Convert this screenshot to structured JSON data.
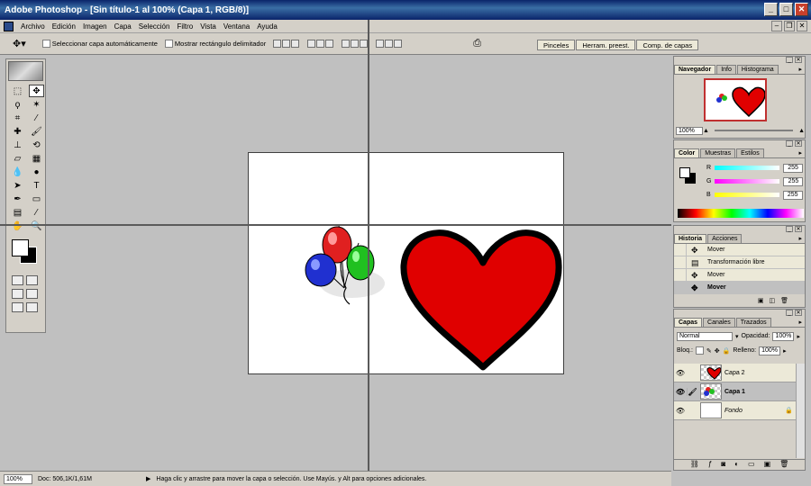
{
  "window": {
    "title": "Adobe Photoshop - [Sin título-1 al 100% (Capa 1, RGB/8)]"
  },
  "menu": [
    "Archivo",
    "Edición",
    "Imagen",
    "Capa",
    "Selección",
    "Filtro",
    "Vista",
    "Ventana",
    "Ayuda"
  ],
  "options": {
    "auto_select_label": "Seleccionar capa automáticamente",
    "show_bounds_label": "Mostrar rectángulo delimitador"
  },
  "wells": [
    "Pinceles",
    "Herram. preest.",
    "Comp. de capas"
  ],
  "navigator": {
    "tabs": [
      "Navegador",
      "Info",
      "Histograma"
    ],
    "zoom": "100%"
  },
  "color": {
    "tabs": [
      "Color",
      "Muestras",
      "Estilos"
    ],
    "r_label": "R",
    "g_label": "G",
    "b_label": "B",
    "r": "255",
    "g": "255",
    "b": "255"
  },
  "history": {
    "tabs": [
      "Historia",
      "Acciones"
    ],
    "items": [
      "Mover",
      "Transformación libre",
      "Mover",
      "Mover"
    ]
  },
  "layers": {
    "tabs": [
      "Capas",
      "Canales",
      "Trazados"
    ],
    "blend_mode": "Normal",
    "opacity_label": "Opacidad:",
    "opacity": "100%",
    "lock_label": "Bloq.:",
    "fill_label": "Relleno:",
    "fill": "100%",
    "items": [
      {
        "name": "Capa 2"
      },
      {
        "name": "Capa 1"
      },
      {
        "name": "Fondo"
      }
    ]
  },
  "status": {
    "zoom": "100%",
    "doc": "Doc: 506,1K/1,61M",
    "hint": "Haga clic y arrastre para mover la capa o selección. Use Mayús. y Alt para opciones adicionales."
  },
  "colors": {
    "heart": "#e00000",
    "balloon_red": "#e02020",
    "balloon_green": "#20c020",
    "balloon_blue": "#2030d0",
    "title_bar": "#0a246a"
  }
}
